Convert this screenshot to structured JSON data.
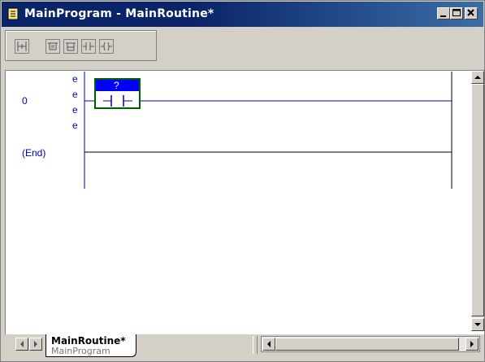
{
  "window": {
    "title": "MainProgram - MainRoutine*"
  },
  "toolbar": {
    "tools": [
      "rung-tool-icon",
      "branch-tool-icon",
      "branch-level-icon",
      "xic-tool-icon",
      "ote-tool-icon"
    ]
  },
  "ladder": {
    "rungs": [
      {
        "number": "0",
        "edit_markers": [
          "e",
          "e",
          "e",
          "e"
        ],
        "tag": "?"
      },
      {
        "number": "(End)"
      }
    ]
  },
  "routine_tab": {
    "name": "MainRoutine*",
    "program": "MainProgram"
  },
  "colors": {
    "rail": "#0000c0",
    "instruction_box": "#006000",
    "tag_highlight": "#0000ff"
  }
}
